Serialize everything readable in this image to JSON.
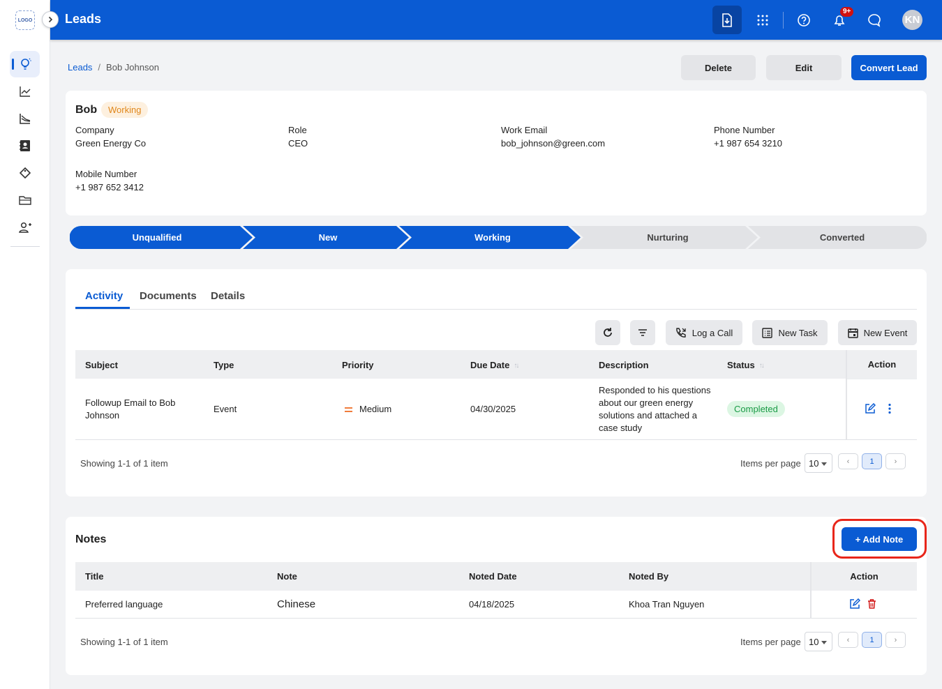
{
  "app": {
    "logo_text": "LOGO",
    "page_title": "Leads"
  },
  "header": {
    "notification_count": "9+",
    "avatar_initials": "KN"
  },
  "breadcrumb": {
    "parent": "Leads",
    "separator": "/",
    "current": "Bob Johnson"
  },
  "actions": {
    "delete": "Delete",
    "edit": "Edit",
    "convert": "Convert Lead"
  },
  "lead": {
    "name": "Bob",
    "status": "Working",
    "fields": [
      {
        "label": "Company",
        "value": "Green Energy Co"
      },
      {
        "label": "Role",
        "value": "CEO"
      },
      {
        "label": "Work Email",
        "value": "bob_johnson@green.com"
      },
      {
        "label": "Phone Number",
        "value": "+1 987 654 3210"
      },
      {
        "label": "Mobile Number",
        "value": "+1 987 652 3412"
      }
    ]
  },
  "stages": [
    {
      "label": "Unqualified",
      "complete": true
    },
    {
      "label": "New",
      "complete": true
    },
    {
      "label": "Working",
      "complete": true
    },
    {
      "label": "Nurturing",
      "complete": false
    },
    {
      "label": "Converted",
      "complete": false
    }
  ],
  "tabs": [
    "Activity",
    "Documents",
    "Details"
  ],
  "activity_toolbar": {
    "log_call": "Log a Call",
    "new_task": "New Task",
    "new_event": "New Event"
  },
  "activity_table": {
    "columns": [
      "Subject",
      "Type",
      "Priority",
      "Due Date",
      "Description",
      "Status",
      "Action"
    ],
    "rows": [
      {
        "subject": [
          "Followup Email to Bob",
          "Johnson"
        ],
        "type": "Event",
        "priority": "Medium",
        "due_date": "04/30/2025",
        "description": [
          "Responded to his questions",
          "about our green energy",
          "solutions and attached a",
          "case study"
        ],
        "status": "Completed"
      }
    ],
    "summary": "Showing 1-1 of 1 item",
    "per_page_label": "Items per page",
    "per_page": "10",
    "current_page": "1"
  },
  "notes": {
    "title": "Notes",
    "add_button": "+ Add Note",
    "columns": [
      "Title",
      "Note",
      "Noted Date",
      "Noted By",
      "Action"
    ],
    "rows": [
      {
        "title": "Preferred language",
        "note": "Chinese",
        "date": "04/18/2025",
        "by": "Khoa Tran Nguyen"
      }
    ],
    "summary": "Showing 1-1 of 1 item",
    "per_page_label": "Items per page",
    "per_page": "10",
    "current_page": "1"
  },
  "colors": {
    "primary": "#0a5bd3",
    "highlight_ring": "#e8261a",
    "working": "#e0871b",
    "completed": "#1a9b46",
    "danger": "#d01010"
  }
}
